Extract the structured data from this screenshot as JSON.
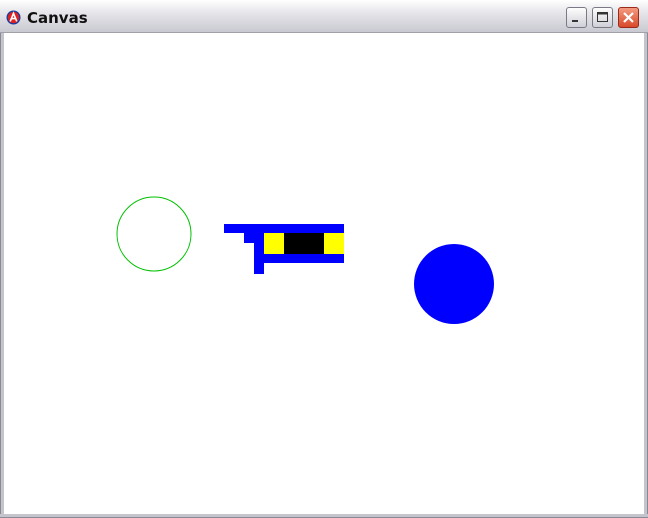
{
  "window": {
    "title": "Canvas",
    "app_icon": "java-icon",
    "controls": {
      "minimize_icon": "minimize-icon",
      "maximize_icon": "maximize-icon",
      "close_icon": "close-icon"
    }
  },
  "canvas": {
    "background": "#ffffff",
    "shapes": [
      {
        "kind": "circle-outline",
        "color": "#00c000"
      },
      {
        "kind": "pixel-sprite",
        "colors": [
          "#0000ff",
          "#ffff00",
          "#000000"
        ]
      },
      {
        "kind": "circle-filled",
        "color": "#0000ff"
      }
    ]
  }
}
